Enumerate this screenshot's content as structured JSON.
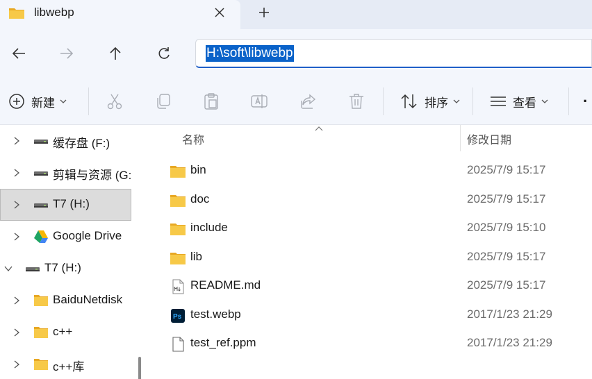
{
  "tab": {
    "title": "libwebp",
    "close_icon": "close-icon",
    "new_tab_icon": "plus-icon"
  },
  "address": {
    "path": "H:\\soft\\libwebp"
  },
  "nav": {
    "back_icon": "arrow-left-icon",
    "forward_icon": "arrow-right-icon",
    "up_icon": "arrow-up-icon",
    "refresh_icon": "refresh-icon"
  },
  "toolbar": {
    "new_label": "新建",
    "sort_label": "排序",
    "view_label": "查看",
    "more_label": "·"
  },
  "sidebar": {
    "items": [
      {
        "label": "缓存盘 (F:)",
        "icon": "drive-icon"
      },
      {
        "label": "剪辑与资源 (G:",
        "icon": "drive-icon"
      },
      {
        "label": "T7 (H:)",
        "icon": "drive-icon",
        "selected": true
      },
      {
        "label": "Google Drive",
        "icon": "google-drive-icon"
      },
      {
        "label": "T7 (H:)",
        "icon": "drive-icon",
        "expanded": true
      },
      {
        "label": "BaiduNetdisk",
        "icon": "folder-icon"
      },
      {
        "label": "c++",
        "icon": "folder-icon"
      },
      {
        "label": "c++库",
        "icon": "folder-icon"
      }
    ]
  },
  "filelist": {
    "columns": {
      "name": "名称",
      "date": "修改日期"
    },
    "rows": [
      {
        "name": "bin",
        "date": "2025/7/9 15:17",
        "icon": "folder-icon"
      },
      {
        "name": "doc",
        "date": "2025/7/9 15:17",
        "icon": "folder-icon"
      },
      {
        "name": "include",
        "date": "2025/7/9 15:10",
        "icon": "folder-icon"
      },
      {
        "name": "lib",
        "date": "2025/7/9 15:17",
        "icon": "folder-icon"
      },
      {
        "name": "README.md",
        "date": "2025/7/9 15:17",
        "icon": "markdown-file-icon"
      },
      {
        "name": "test.webp",
        "date": "2017/1/23 21:29",
        "icon": "photoshop-file-icon"
      },
      {
        "name": "test_ref.ppm",
        "date": "2017/1/23 21:29",
        "icon": "file-icon"
      }
    ]
  },
  "colors": {
    "folder": "#f7c948",
    "accent": "#0a62c9",
    "selection": "#dcdcdc"
  }
}
